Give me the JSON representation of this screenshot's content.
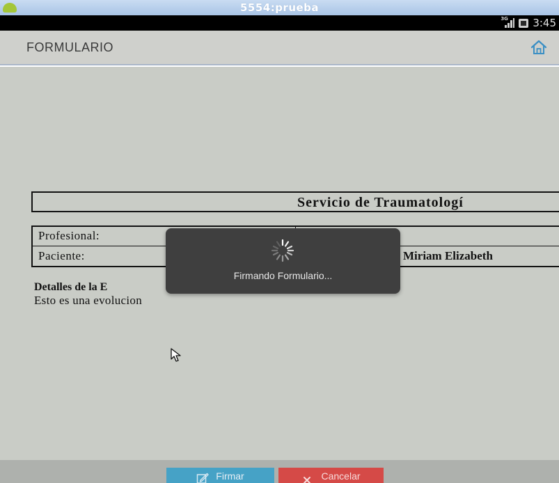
{
  "window": {
    "title": "5554:prueba"
  },
  "status_bar": {
    "network": "3G",
    "time": "3:45"
  },
  "action_bar": {
    "title": "FORMULARIO",
    "home_icon": "home-icon"
  },
  "form": {
    "service_title": "Servicio de Traumatologí",
    "rows": [
      {
        "label": "Profesional:",
        "value": ""
      },
      {
        "label": "Paciente:",
        "value": "Miriam Elizabeth"
      }
    ],
    "details_heading": "Detalles de la E",
    "details_text": "Esto es una evolucion"
  },
  "dialog": {
    "message": "Firmando Formulario..."
  },
  "buttons": {
    "sign_label": "Firmar",
    "cancel_label": "Cancelar"
  },
  "colors": {
    "sign_button": "#46a2c6",
    "cancel_button": "#d54a47",
    "content_background": "#c9ccc6",
    "dialog_background": "#3f3f3f"
  }
}
